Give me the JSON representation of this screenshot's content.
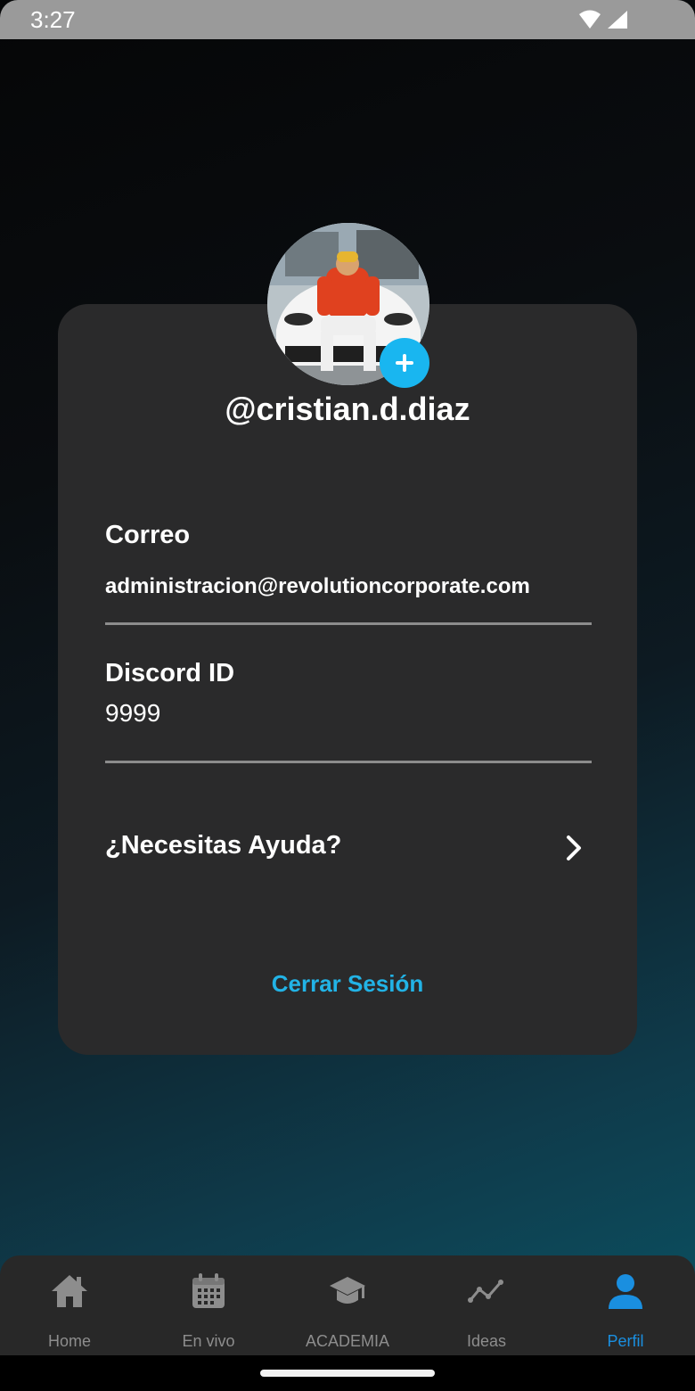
{
  "status_bar": {
    "time": "3:27",
    "icons": [
      "wifi-icon",
      "signal-icon"
    ]
  },
  "profile": {
    "username": "@cristian.d.diaz",
    "avatar": "profile-photo",
    "add_icon": "plus-icon"
  },
  "fields": {
    "email_label": "Correo",
    "email_value": "administracion@revolutioncorporate.com",
    "discord_label": "Discord ID",
    "discord_value": "9999"
  },
  "help": {
    "label": "¿Necesitas Ayuda?",
    "icon": "chevron-right-icon"
  },
  "logout_label": "Cerrar Sesión",
  "colors": {
    "accent": "#22b3e6",
    "active_tab": "#1a8fe0",
    "card_bg": "#2a2a2b"
  },
  "bottom_nav": {
    "items": [
      {
        "label": "Home",
        "icon": "home-icon",
        "active": false
      },
      {
        "label": "En vivo",
        "icon": "calendar-icon",
        "active": false
      },
      {
        "label": "ACADEMIA",
        "icon": "graduation-cap-icon",
        "active": false
      },
      {
        "label": "Ideas",
        "icon": "line-chart-icon",
        "active": false
      },
      {
        "label": "Perfil",
        "icon": "person-icon",
        "active": true
      }
    ]
  }
}
